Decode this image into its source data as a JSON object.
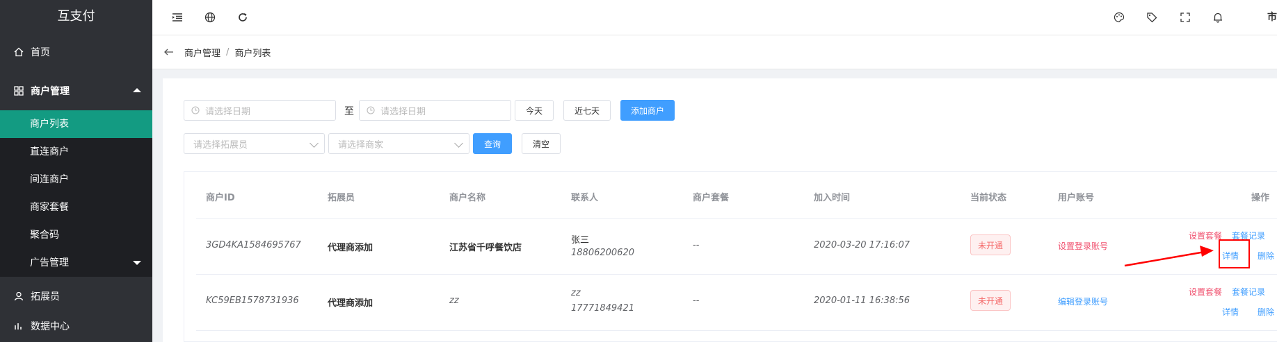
{
  "app": {
    "title": "互支付"
  },
  "sidebar": {
    "items": [
      {
        "label": "首页",
        "icon": "home-icon"
      },
      {
        "label": "商户管理",
        "icon": "grid-icon"
      },
      {
        "label": "拓展员",
        "icon": "user-icon"
      },
      {
        "label": "数据中心",
        "icon": "chart-icon"
      }
    ],
    "submenu": [
      {
        "label": "商户列表",
        "active": true
      },
      {
        "label": "直连商户"
      },
      {
        "label": "间连商户"
      },
      {
        "label": "商家套餐"
      },
      {
        "label": "聚合码"
      },
      {
        "label": "广告管理"
      }
    ]
  },
  "topbar": {
    "icons": [
      "indent-icon",
      "globe-icon",
      "refresh-icon",
      "palette-icon",
      "tag-icon",
      "fullscreen-icon",
      "bell-icon"
    ],
    "user_fragment": "市"
  },
  "breadcrumb": {
    "items": [
      "商户管理",
      "商户列表"
    ],
    "separator": "/"
  },
  "filters": {
    "date_start_placeholder": "请选择日期",
    "to_label": "至",
    "date_end_placeholder": "请选择日期",
    "today_label": "今天",
    "week_label": "近七天",
    "add_label": "添加商户",
    "promoter_placeholder": "请选择拓展员",
    "merchant_placeholder": "请选择商家",
    "query_label": "查询",
    "clear_label": "清空"
  },
  "table": {
    "headers": [
      "商户ID",
      "拓展员",
      "商户名称",
      "联系人",
      "商户套餐",
      "加入时间",
      "当前状态",
      "用户账号",
      "操作"
    ],
    "rows": [
      {
        "id": "3GD4KA1584695767",
        "promoter": "代理商添加",
        "name": "江苏省千呼餐饮店",
        "contact_name": "张三",
        "contact_phone": "18806200620",
        "package": "--",
        "joined": "2020-03-20 17:16:07",
        "status": "未开通",
        "account_action": "设置登录账号",
        "actions": {
          "set_package": "设置套餐",
          "package_log": "套餐记录",
          "detail": "详情",
          "delete": "删除"
        }
      },
      {
        "id": "KC59EB1578731936",
        "promoter": "代理商添加",
        "name": "zz",
        "contact_name": "zz",
        "contact_phone": "17771849421",
        "package": "--",
        "joined": "2020-01-11 16:38:56",
        "status": "未开通",
        "account_action": "编辑登录账号",
        "actions": {
          "set_package": "设置套餐",
          "package_log": "套餐记录",
          "detail": "详情",
          "delete": "删除"
        }
      }
    ]
  },
  "colors": {
    "sidebar_bg": "#2f3136",
    "active_menu": "#139b82",
    "primary": "#409eff",
    "danger": "#f0506e",
    "annotation": "#ff0000"
  }
}
